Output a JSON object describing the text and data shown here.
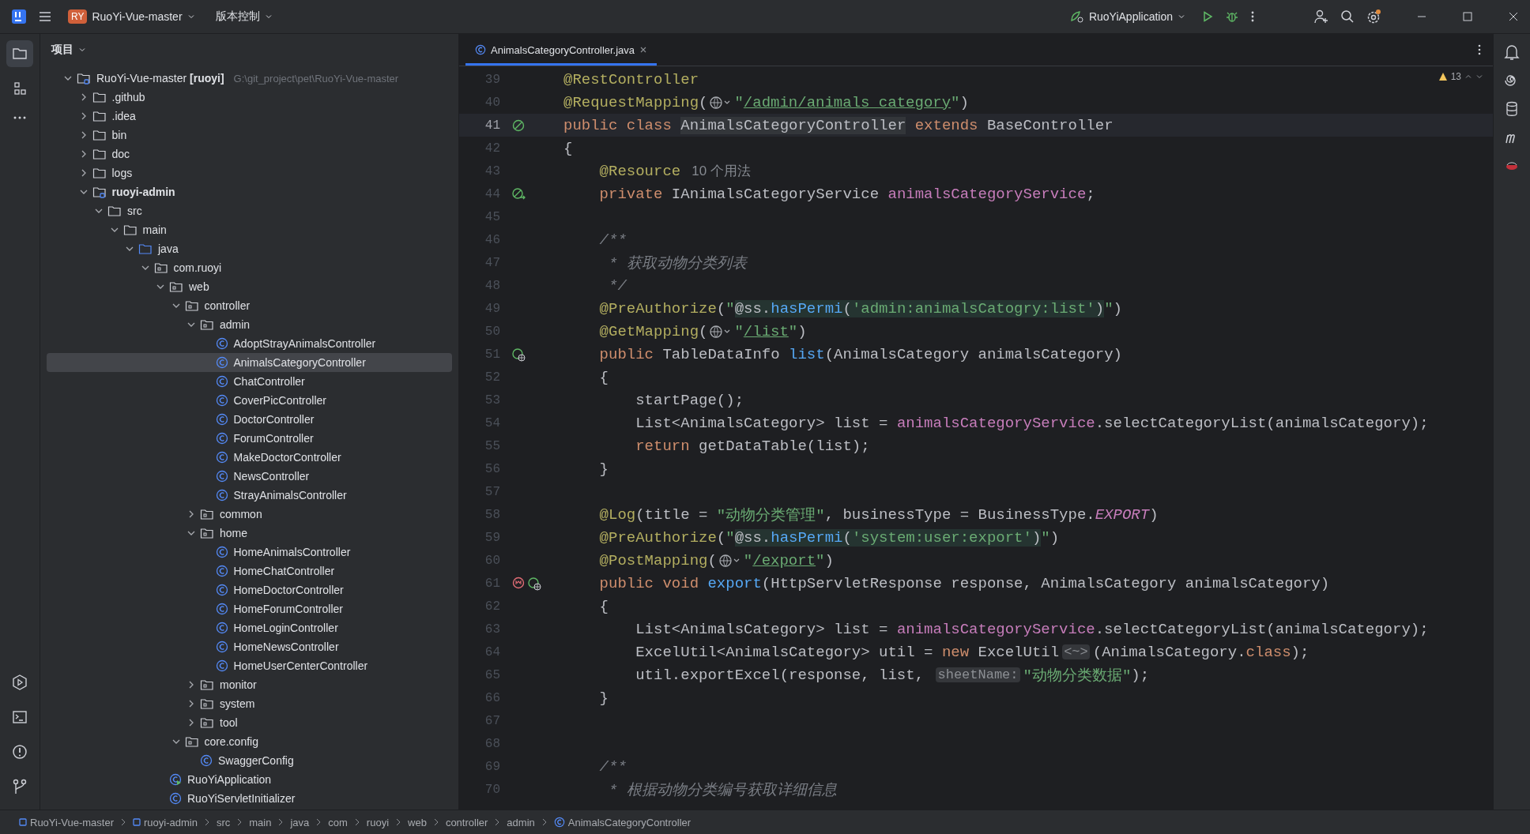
{
  "title_bar": {
    "project_badge": "RY",
    "project": "RuoYi-Vue-master",
    "vcs": "版本控制",
    "run_config": "RuoYiApplication"
  },
  "project_panel": {
    "title": "项目",
    "tree": [
      {
        "kind": "module",
        "label": "RuoYi-Vue-master **[ruoyi]**",
        "path": "G:\\git_project\\pet\\RuoYi-Vue-master",
        "expanded": true,
        "selected": false,
        "children": [
          {
            "kind": "folder",
            "label": ".github",
            "expanded": false,
            "selected": false
          },
          {
            "kind": "folder",
            "label": ".idea",
            "expanded": false,
            "selected": false
          },
          {
            "kind": "folder",
            "label": "bin",
            "expanded": false,
            "selected": false
          },
          {
            "kind": "folder",
            "label": "doc",
            "expanded": false,
            "selected": false
          },
          {
            "kind": "folder",
            "label": "logs",
            "expanded": false,
            "selected": false
          },
          {
            "kind": "module",
            "label": "ruoyi-admin",
            "bold": true,
            "expanded": true,
            "selected": false,
            "children": [
              {
                "kind": "folder",
                "label": "src",
                "expanded": true,
                "selected": false,
                "children": [
                  {
                    "kind": "folder",
                    "label": "main",
                    "expanded": true,
                    "selected": false,
                    "children": [
                      {
                        "kind": "source",
                        "label": "java",
                        "expanded": true,
                        "selected": false,
                        "children": [
                          {
                            "kind": "package",
                            "label": "com.ruoyi",
                            "expanded": true,
                            "selected": false,
                            "children": [
                              {
                                "kind": "package",
                                "label": "web",
                                "expanded": true,
                                "selected": false,
                                "children": [
                                  {
                                    "kind": "package",
                                    "label": "controller",
                                    "expanded": true,
                                    "selected": false,
                                    "children": [
                                      {
                                        "kind": "package",
                                        "label": "admin",
                                        "expanded": true,
                                        "selected": false,
                                        "children": [
                                          {
                                            "kind": "class",
                                            "label": "AdoptStrayAnimalsController",
                                            "selected": false
                                          },
                                          {
                                            "kind": "class",
                                            "label": "AnimalsCategoryController",
                                            "selected": true
                                          },
                                          {
                                            "kind": "class",
                                            "label": "ChatController",
                                            "selected": false
                                          },
                                          {
                                            "kind": "class",
                                            "label": "CoverPicController",
                                            "selected": false
                                          },
                                          {
                                            "kind": "class",
                                            "label": "DoctorController",
                                            "selected": false
                                          },
                                          {
                                            "kind": "class",
                                            "label": "ForumController",
                                            "selected": false
                                          },
                                          {
                                            "kind": "class",
                                            "label": "MakeDoctorController",
                                            "selected": false
                                          },
                                          {
                                            "kind": "class",
                                            "label": "NewsController",
                                            "selected": false
                                          },
                                          {
                                            "kind": "class",
                                            "label": "StrayAnimalsController",
                                            "selected": false
                                          }
                                        ]
                                      },
                                      {
                                        "kind": "package",
                                        "label": "common",
                                        "expanded": false,
                                        "selected": false
                                      },
                                      {
                                        "kind": "package",
                                        "label": "home",
                                        "expanded": true,
                                        "selected": false,
                                        "children": [
                                          {
                                            "kind": "class",
                                            "label": "HomeAnimalsController",
                                            "selected": false
                                          },
                                          {
                                            "kind": "class",
                                            "label": "HomeChatController",
                                            "selected": false
                                          },
                                          {
                                            "kind": "class",
                                            "label": "HomeDoctorController",
                                            "selected": false
                                          },
                                          {
                                            "kind": "class",
                                            "label": "HomeForumController",
                                            "selected": false
                                          },
                                          {
                                            "kind": "class",
                                            "label": "HomeLoginController",
                                            "selected": false
                                          },
                                          {
                                            "kind": "class",
                                            "label": "HomeNewsController",
                                            "selected": false
                                          },
                                          {
                                            "kind": "class",
                                            "label": "HomeUserCenterController",
                                            "selected": false
                                          }
                                        ]
                                      },
                                      {
                                        "kind": "package",
                                        "label": "monitor",
                                        "expanded": false,
                                        "selected": false
                                      },
                                      {
                                        "kind": "package",
                                        "label": "system",
                                        "expanded": false,
                                        "selected": false
                                      },
                                      {
                                        "kind": "package",
                                        "label": "tool",
                                        "expanded": false,
                                        "selected": false
                                      }
                                    ]
                                  },
                                  {
                                    "kind": "package",
                                    "label": "core.config",
                                    "expanded": true,
                                    "selected": false,
                                    "children": [
                                      {
                                        "kind": "class",
                                        "label": "SwaggerConfig",
                                        "selected": false
                                      }
                                    ]
                                  }
                                ]
                              },
                              {
                                "kind": "app",
                                "label": "RuoYiApplication",
                                "selected": false
                              },
                              {
                                "kind": "class",
                                "label": "RuoYiServletInitializer",
                                "selected": false
                              }
                            ]
                          }
                        ]
                      }
                    ]
                  }
                ]
              }
            ]
          }
        ]
      }
    ]
  },
  "editor": {
    "tabs": [
      {
        "label": "AnimalsCategoryController.java",
        "selected": true
      }
    ],
    "warnings": "13",
    "lines": [
      {
        "n": "39",
        "selected": false,
        "tokens": [
          {
            "kind": "ann",
            "t": "@RestController"
          }
        ]
      },
      {
        "n": "40",
        "selected": false,
        "tokens": [
          {
            "kind": "ann",
            "t": "@RequestMapping"
          },
          {
            "kind": "plain",
            "t": "("
          },
          {
            "kind": "globe"
          },
          {
            "kind": "str",
            "t": "\""
          },
          {
            "kind": "link",
            "t": "/admin/animals_category"
          },
          {
            "kind": "str",
            "t": "\""
          },
          {
            "kind": "plain",
            "t": ")"
          }
        ]
      },
      {
        "n": "41",
        "selected": true,
        "markers": [
          {
            "kind": "bean"
          }
        ],
        "tokens": [
          {
            "kind": "kw",
            "t": "public class "
          },
          {
            "kind": "hl",
            "t": "AnimalsCategoryController"
          },
          {
            "kind": "kw",
            "t": " extends "
          },
          {
            "kind": "plain",
            "t": "BaseController"
          }
        ]
      },
      {
        "n": "42",
        "selected": false,
        "tokens": [
          {
            "kind": "plain",
            "t": "{"
          }
        ]
      },
      {
        "n": "43",
        "selected": false,
        "tokens": [
          {
            "kind": "ann",
            "t": "    @Resource"
          },
          {
            "kind": "usage",
            "t": "10 个用法"
          }
        ]
      },
      {
        "n": "44",
        "selected": false,
        "markers": [
          {
            "kind": "inject"
          }
        ],
        "tokens": [
          {
            "kind": "kw",
            "t": "    private "
          },
          {
            "kind": "plain",
            "t": "IAnimalsCategoryService "
          },
          {
            "kind": "field",
            "t": "animalsCategoryService"
          },
          {
            "kind": "plain",
            "t": ";"
          }
        ]
      },
      {
        "n": "45",
        "selected": false
      },
      {
        "n": "46",
        "selected": false,
        "tokens": [
          {
            "kind": "comment",
            "t": "    /**"
          }
        ]
      },
      {
        "n": "47",
        "selected": false,
        "tokens": [
          {
            "kind": "comment",
            "t": "     * 获取动物分类列表"
          }
        ]
      },
      {
        "n": "48",
        "selected": false,
        "tokens": [
          {
            "kind": "comment",
            "t": "     */"
          }
        ]
      },
      {
        "n": "49",
        "selected": false,
        "tokens": [
          {
            "kind": "ann",
            "t": "    @PreAuthorize"
          },
          {
            "kind": "plain",
            "t": "("
          },
          {
            "kind": "str",
            "t": "\""
          },
          {
            "kind": "inj",
            "t": "@ss."
          },
          {
            "kind": "injm",
            "t": "hasPermi"
          },
          {
            "kind": "inj",
            "t": "("
          },
          {
            "kind": "injs",
            "t": "'admin:animalsCatogry:list'"
          },
          {
            "kind": "inj",
            "t": ")"
          },
          {
            "kind": "str",
            "t": "\""
          },
          {
            "kind": "plain",
            "t": ")"
          }
        ]
      },
      {
        "n": "50",
        "selected": false,
        "tokens": [
          {
            "kind": "ann",
            "t": "    @GetMapping"
          },
          {
            "kind": "plain",
            "t": "("
          },
          {
            "kind": "globe"
          },
          {
            "kind": "str",
            "t": "\""
          },
          {
            "kind": "link",
            "t": "/list"
          },
          {
            "kind": "str",
            "t": "\""
          },
          {
            "kind": "plain",
            "t": ")"
          }
        ]
      },
      {
        "n": "51",
        "selected": false,
        "markers": [
          {
            "kind": "web"
          }
        ],
        "tokens": [
          {
            "kind": "kw",
            "t": "    public "
          },
          {
            "kind": "plain",
            "t": "TableDataInfo "
          },
          {
            "kind": "method",
            "t": "list"
          },
          {
            "kind": "plain",
            "t": "(AnimalsCategory animalsCategory)"
          }
        ]
      },
      {
        "n": "52",
        "selected": false,
        "tokens": [
          {
            "kind": "plain",
            "t": "    {"
          }
        ]
      },
      {
        "n": "53",
        "selected": false,
        "tokens": [
          {
            "kind": "plain",
            "t": "        startPage();"
          }
        ]
      },
      {
        "n": "54",
        "selected": false,
        "tokens": [
          {
            "kind": "plain",
            "t": "        List<AnimalsCategory> list = "
          },
          {
            "kind": "field",
            "t": "animalsCategoryService"
          },
          {
            "kind": "plain",
            "t": ".selectCategoryList(animalsCategory);"
          }
        ]
      },
      {
        "n": "55",
        "selected": false,
        "tokens": [
          {
            "kind": "kw",
            "t": "        return "
          },
          {
            "kind": "plain",
            "t": "getDataTable(list);"
          }
        ]
      },
      {
        "n": "56",
        "selected": false,
        "tokens": [
          {
            "kind": "plain",
            "t": "    }"
          }
        ]
      },
      {
        "n": "57",
        "selected": false
      },
      {
        "n": "58",
        "selected": false,
        "tokens": [
          {
            "kind": "ann",
            "t": "    @Log"
          },
          {
            "kind": "plain",
            "t": "(title = "
          },
          {
            "kind": "str",
            "t": "\"动物分类管理\""
          },
          {
            "kind": "plain",
            "t": ", businessType = BusinessType."
          },
          {
            "kind": "static",
            "t": "EXPORT"
          },
          {
            "kind": "plain",
            "t": ")"
          }
        ]
      },
      {
        "n": "59",
        "selected": false,
        "tokens": [
          {
            "kind": "ann",
            "t": "    @PreAuthorize"
          },
          {
            "kind": "plain",
            "t": "("
          },
          {
            "kind": "str",
            "t": "\""
          },
          {
            "kind": "inj",
            "t": "@ss."
          },
          {
            "kind": "injm",
            "t": "hasPermi"
          },
          {
            "kind": "inj",
            "t": "("
          },
          {
            "kind": "injs",
            "t": "'system:user:export'"
          },
          {
            "kind": "inj",
            "t": ")"
          },
          {
            "kind": "str",
            "t": "\""
          },
          {
            "kind": "plain",
            "t": ")"
          }
        ]
      },
      {
        "n": "60",
        "selected": false,
        "tokens": [
          {
            "kind": "ann",
            "t": "    @PostMapping"
          },
          {
            "kind": "plain",
            "t": "("
          },
          {
            "kind": "globe"
          },
          {
            "kind": "str",
            "t": "\""
          },
          {
            "kind": "link",
            "t": "/export"
          },
          {
            "kind": "str",
            "t": "\""
          },
          {
            "kind": "plain",
            "t": ")"
          }
        ]
      },
      {
        "n": "61",
        "selected": false,
        "markers": [
          {
            "kind": "override"
          },
          {
            "kind": "web"
          }
        ],
        "tokens": [
          {
            "kind": "kw",
            "t": "    public void "
          },
          {
            "kind": "method",
            "t": "export"
          },
          {
            "kind": "plain",
            "t": "(HttpServletResponse response, AnimalsCategory animalsCategory)"
          }
        ]
      },
      {
        "n": "62",
        "selected": false,
        "tokens": [
          {
            "kind": "plain",
            "t": "    {"
          }
        ]
      },
      {
        "n": "63",
        "selected": false,
        "tokens": [
          {
            "kind": "plain",
            "t": "        List<AnimalsCategory> list = "
          },
          {
            "kind": "field",
            "t": "animalsCategoryService"
          },
          {
            "kind": "plain",
            "t": ".selectCategoryList(animalsCategory);"
          }
        ]
      },
      {
        "n": "64",
        "selected": false,
        "tokens": [
          {
            "kind": "plain",
            "t": "        ExcelUtil<AnimalsCategory> util = "
          },
          {
            "kind": "kw",
            "t": "new "
          },
          {
            "kind": "plain",
            "t": "ExcelUtil"
          },
          {
            "kind": "hint",
            "t": "<~>"
          },
          {
            "kind": "plain",
            "t": "(AnimalsCategory."
          },
          {
            "kind": "kw",
            "t": "class"
          },
          {
            "kind": "plain",
            "t": ");"
          }
        ]
      },
      {
        "n": "65",
        "selected": false,
        "tokens": [
          {
            "kind": "plain",
            "t": "        util.exportExcel(response, list, "
          },
          {
            "kind": "hint",
            "t": "sheetName:"
          },
          {
            "kind": "str",
            "t": "\"动物分类数据\""
          },
          {
            "kind": "plain",
            "t": ");"
          }
        ]
      },
      {
        "n": "66",
        "selected": false,
        "tokens": [
          {
            "kind": "plain",
            "t": "    }"
          }
        ]
      },
      {
        "n": "67",
        "selected": false
      },
      {
        "n": "68",
        "selected": false
      },
      {
        "n": "69",
        "selected": false,
        "tokens": [
          {
            "kind": "comment",
            "t": "    /**"
          }
        ]
      },
      {
        "n": "70",
        "selected": false,
        "tokens": [
          {
            "kind": "comment",
            "t": "     * 根据动物分类编号获取详细信息"
          }
        ]
      }
    ]
  },
  "breadcrumbs": [
    {
      "kind": "module",
      "label": "RuoYi-Vue-master"
    },
    {
      "kind": "module",
      "label": "ruoyi-admin"
    },
    {
      "kind": "plain",
      "label": "src"
    },
    {
      "kind": "plain",
      "label": "main"
    },
    {
      "kind": "plain",
      "label": "java"
    },
    {
      "kind": "plain",
      "label": "com"
    },
    {
      "kind": "plain",
      "label": "ruoyi"
    },
    {
      "kind": "plain",
      "label": "web"
    },
    {
      "kind": "plain",
      "label": "controller"
    },
    {
      "kind": "plain",
      "label": "admin"
    },
    {
      "kind": "class",
      "label": "AnimalsCategoryController"
    }
  ]
}
